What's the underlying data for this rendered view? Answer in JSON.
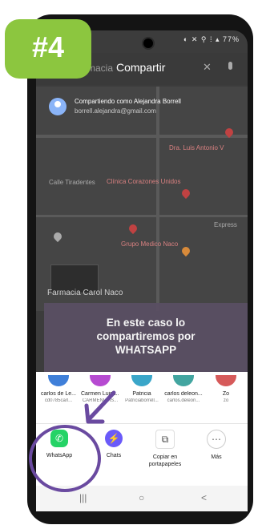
{
  "status": {
    "icons": "◐ ✕ ⚲ ⁞ ▴ 77%"
  },
  "search": {
    "background_text": "Farmacia",
    "sheet_title": "Compartir"
  },
  "account": {
    "name": "Compartiendo como Alejandra Borrell",
    "email": "borrell.alejandra@gmail.com"
  },
  "map": {
    "labels": [
      "Dra. Luis Antonio V",
      "Clínica Corazones Unidos",
      "Grupo Medico Naco",
      "Express"
    ],
    "street": "Calle Tiradentes"
  },
  "place": {
    "name": "Farmacia Carol Naco"
  },
  "badge": {
    "text": "#4"
  },
  "caption": {
    "lines": [
      "En este caso lo",
      "compartiremos por",
      "WHATSAPP"
    ]
  },
  "contacts": [
    {
      "name": "carlos de Le...",
      "sub": "cd0785carl...",
      "color": "#3f7fd9"
    },
    {
      "name": "Carmen Luisa...",
      "sub": "CARMENLUIS...",
      "color": "#b64ad1"
    },
    {
      "name": "Patricia",
      "sub": "Patriciaborrell...",
      "color": "#3aa6c9"
    },
    {
      "name": "carlos deleon...",
      "sub": "carlos.deleon...",
      "color": "#42a5a0"
    },
    {
      "name": "Zo",
      "sub": "zo",
      "color": "#d65a5a"
    }
  ],
  "apps": [
    {
      "label": "WhatsApp",
      "icon": "whatsapp-icon",
      "glyph": "✆",
      "color": "#25d366"
    },
    {
      "label": "Chats",
      "icon": "messenger-icon",
      "glyph": "⚡",
      "color": "#6a5af9"
    },
    {
      "label": "Copiar en portapapeles",
      "icon": "copy-icon",
      "glyph": "⧉",
      "color": "#ffffff"
    },
    {
      "label": "Más",
      "icon": "more-icon",
      "glyph": "⋯",
      "color": "#ffffff"
    }
  ],
  "nav": {
    "recent": "|||",
    "home": "○",
    "back": "<"
  },
  "colors": {
    "badge": "#8cc63f",
    "caption_bg": "#5a4f63",
    "highlight": "#6a4aa0"
  }
}
